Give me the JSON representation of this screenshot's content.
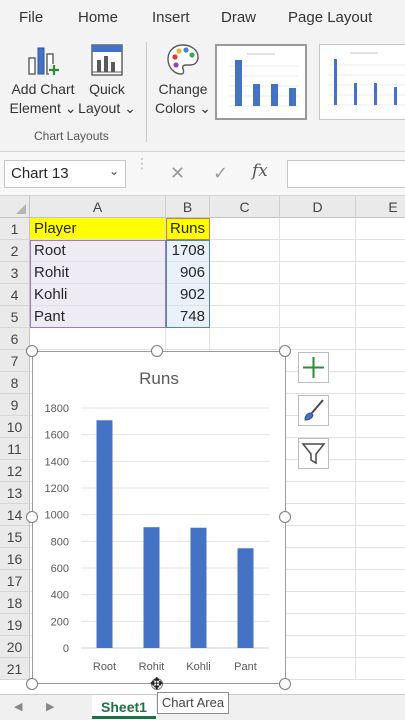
{
  "ribbon": {
    "tabs": [
      "File",
      "Home",
      "Insert",
      "Draw",
      "Page Layout"
    ],
    "add_chart_element": [
      "Add Chart",
      "Element ⌄"
    ],
    "quick_layout": [
      "Quick",
      "Layout ⌄"
    ],
    "change_colors": [
      "Change",
      "Colors ⌄"
    ],
    "group_label": "Chart Layouts"
  },
  "formula_bar": {
    "name_box": "Chart 13",
    "cancel_icon": "✕",
    "enter_icon": "✓",
    "fx": "fx"
  },
  "columns": [
    "A",
    "B",
    "C",
    "D",
    "E"
  ],
  "rows": [
    "1",
    "2",
    "3",
    "4",
    "5",
    "6",
    "7",
    "8",
    "9",
    "10",
    "11",
    "12",
    "13",
    "14",
    "15",
    "16",
    "17",
    "18",
    "19",
    "20",
    "21"
  ],
  "sheet": {
    "header": [
      "Player",
      "Runs"
    ],
    "data": [
      [
        "Root",
        "1708"
      ],
      [
        "Rohit",
        "906"
      ],
      [
        "Kohli",
        "902"
      ],
      [
        "Pant",
        "748"
      ]
    ]
  },
  "chart_data": {
    "type": "bar",
    "title": "Runs",
    "categories": [
      "Root",
      "Rohit",
      "Kohli",
      "Pant"
    ],
    "values": [
      1708,
      906,
      902,
      748
    ],
    "ylim": [
      0,
      1800
    ],
    "yticks": [
      "0",
      "200",
      "400",
      "600",
      "800",
      "1000",
      "1200",
      "1400",
      "1600",
      "1800"
    ],
    "grid": true,
    "bar_color": "#4472c4"
  },
  "sheet_tabs": {
    "active": "Sheet1"
  },
  "tooltip": "Chart Area",
  "colors": {
    "excel_green": "#1e7145",
    "header_fill": "#ffff00"
  }
}
